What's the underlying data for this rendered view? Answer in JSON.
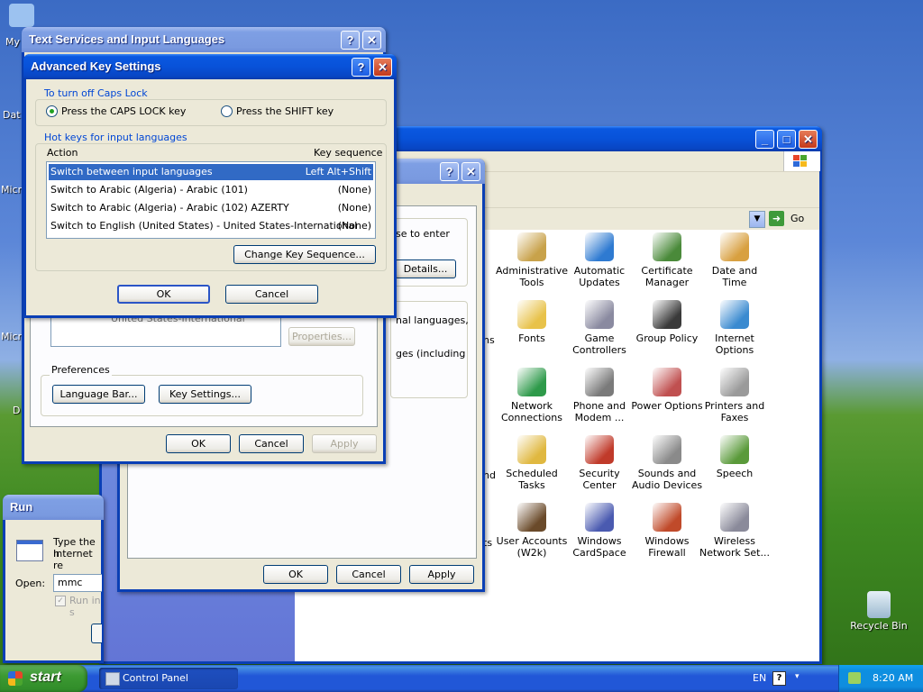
{
  "desktop": {
    "left_labels": [
      "My",
      "Dat",
      "Micr",
      "Micr",
      "D"
    ],
    "recycle_bin": "Recycle Bin"
  },
  "control_panel": {
    "address": {
      "go": "Go"
    },
    "icons": [
      {
        "label": "Administrative Tools",
        "icon": "admin-tools-icon",
        "color": "#c8a24a"
      },
      {
        "label": "Automatic Updates",
        "icon": "windows-flag-icon",
        "color": "#2e7ad1"
      },
      {
        "label": "Certificate Manager",
        "icon": "certificate-icon",
        "color": "#4a8a3a"
      },
      {
        "label": "Date and Time",
        "icon": "clock-icon",
        "color": "#d8a040"
      },
      {
        "label": "Fonts",
        "icon": "fonts-folder-icon",
        "color": "#e8c24a"
      },
      {
        "label": "Game Controllers",
        "icon": "gamepad-icon",
        "color": "#8a8aa0"
      },
      {
        "label": "Group Policy",
        "icon": "group-policy-icon",
        "color": "#3a3a3a"
      },
      {
        "label": "Internet Options",
        "icon": "globe-icon",
        "color": "#3a8ad0"
      },
      {
        "label": "Network Connections",
        "icon": "network-globe-icon",
        "color": "#2e9a4a"
      },
      {
        "label": "Phone and Modem ...",
        "icon": "phone-icon",
        "color": "#7a7a7a"
      },
      {
        "label": "Power Options",
        "icon": "power-icon",
        "color": "#c05050"
      },
      {
        "label": "Printers and Faxes",
        "icon": "printer-icon",
        "color": "#9a9a9a"
      },
      {
        "label": "Scheduled Tasks",
        "icon": "scheduled-folder-icon",
        "color": "#e0b840"
      },
      {
        "label": "Security Center",
        "icon": "shield-icon",
        "color": "#c03a2a"
      },
      {
        "label": "Sounds and Audio Devices",
        "icon": "speaker-icon",
        "color": "#8a8a8a"
      },
      {
        "label": "Speech",
        "icon": "speech-icon",
        "color": "#5a9a3a"
      },
      {
        "label": "User Accounts (W2k)",
        "icon": "user-accounts-icon",
        "color": "#6a4a2a"
      },
      {
        "label": "Windows CardSpace",
        "icon": "cardspace-icon",
        "color": "#4a5ab0"
      },
      {
        "label": "Windows Firewall",
        "icon": "firewall-icon",
        "color": "#c04a2a"
      },
      {
        "label": "Wireless Network Set...",
        "icon": "wireless-icon",
        "color": "#8a8a9a"
      }
    ],
    "partial_left_labels": [
      "ns",
      "nd",
      "ts"
    ]
  },
  "regional_dialog": {
    "partial_text_1": "se to enter",
    "details_button": "Details...",
    "partial_text_2": "nal languages,",
    "partial_text_3": "ges (including",
    "ok": "OK",
    "cancel": "Cancel",
    "apply": "Apply"
  },
  "text_services": {
    "title": "Text Services and Input Languages",
    "partial_list_text": "United States-International",
    "properties_button": "Properties...",
    "preferences_label": "Preferences",
    "language_bar_button": "Language Bar...",
    "key_settings_button": "Key Settings...",
    "ok": "OK",
    "cancel": "Cancel",
    "apply": "Apply"
  },
  "advanced_key_settings": {
    "title": "Advanced Key Settings",
    "caps_group_label": "To turn off Caps Lock",
    "caps_option": "Press the CAPS LOCK key",
    "shift_option": "Press the SHIFT key",
    "hotkeys_group_label": "Hot keys for input languages",
    "col_action": "Action",
    "col_key": "Key sequence",
    "rows": [
      {
        "action": "Switch between input languages",
        "key": "Left Alt+Shift"
      },
      {
        "action": "Switch to Arabic (Algeria) - Arabic (101)",
        "key": "(None)"
      },
      {
        "action": "Switch to Arabic (Algeria) - Arabic (102) AZERTY",
        "key": "(None)"
      },
      {
        "action": "Switch to English (United States) - United States-International",
        "key": "(None)"
      }
    ],
    "change_button": "Change Key Sequence...",
    "ok": "OK",
    "cancel": "Cancel"
  },
  "run_dialog": {
    "title": "Run",
    "desc_1": "Type the n",
    "desc_2": "Internet re",
    "open_label": "Open:",
    "open_value": "mmc",
    "checkbox_label": "Run in s"
  },
  "taskbar": {
    "start": "start",
    "task_control_panel": "Control Panel",
    "lang": "EN",
    "clock": "8:20 AM"
  }
}
